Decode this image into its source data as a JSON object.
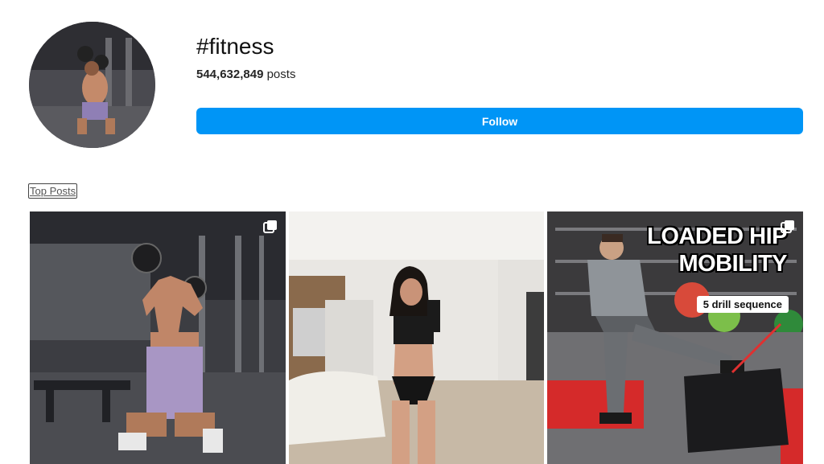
{
  "header": {
    "hashtag": "#fitness",
    "post_count": "544,632,849",
    "post_count_suffix": "posts",
    "follow_label": "Follow"
  },
  "section": {
    "label": "Top Posts"
  },
  "posts": [
    {
      "type": "carousel",
      "icon": "multiple-images-icon",
      "image": "man kneeling holding kettlebells overhead in gym"
    },
    {
      "type": "photo",
      "image": "woman taking mirror selfie in living room"
    },
    {
      "type": "carousel",
      "icon": "multiple-images-icon",
      "overlay_title_1": "LOADED HIP",
      "overlay_title_2": "MOBILITY",
      "overlay_tag": "5 drill sequence"
    }
  ],
  "colors": {
    "accent": "#0095f6"
  }
}
